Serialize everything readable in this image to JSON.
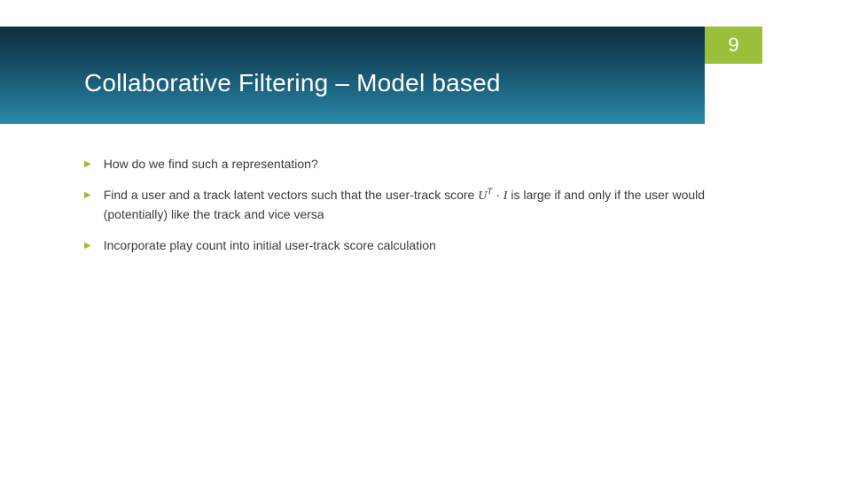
{
  "slide": {
    "page_number": "9",
    "title": "Collaborative Filtering – Model based"
  },
  "bullets": [
    {
      "text": "How do we find such a representation?"
    },
    {
      "pre": "Find a user and a track latent vectors such that the user-track score ",
      "math_U": "U",
      "math_T": "T",
      "math_dot": " · ",
      "math_I": "I",
      "post": " is large if and only if the user would (potentially) like the track and vice versa"
    },
    {
      "text": "Incorporate play count into initial user-track score calculation"
    }
  ]
}
